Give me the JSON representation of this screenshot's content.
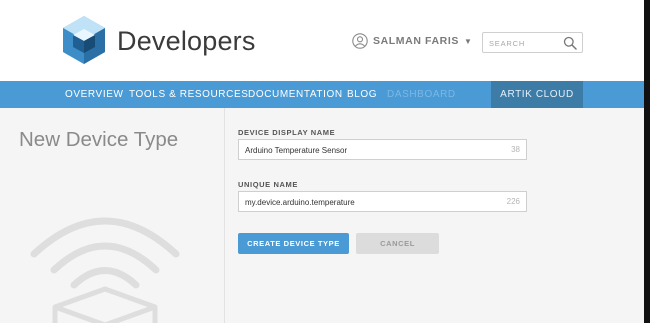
{
  "header": {
    "brand": "Developers",
    "user_name": "SALMAN FARIS",
    "caret": "▼",
    "search_placeholder": "SEARCH"
  },
  "nav": {
    "items": [
      {
        "label": "OVERVIEW"
      },
      {
        "label": "TOOLS & RESOURCES"
      },
      {
        "label": "DOCUMENTATION"
      },
      {
        "label": "BLOG"
      },
      {
        "label": "DASHBOARD"
      }
    ],
    "cloud_label": "ARTIK CLOUD"
  },
  "page": {
    "title": "New Device Type"
  },
  "form": {
    "display_name_label": "DEVICE DISPLAY NAME",
    "display_name_value": "Arduino Temperature Sensor",
    "display_name_counter": "38",
    "unique_name_label": "UNIQUE NAME",
    "unique_name_value": "my.device.arduino.temperature",
    "unique_name_counter": "226",
    "create_label": "CREATE DEVICE TYPE",
    "cancel_label": "CANCEL"
  },
  "colors": {
    "accent": "#4a9ad5",
    "nav_active": "#3e7ca8",
    "background": "#f5f5f5"
  },
  "icons": [
    "cube-logo-icon",
    "user-icon",
    "search-icon",
    "wifi-device-icon"
  ]
}
